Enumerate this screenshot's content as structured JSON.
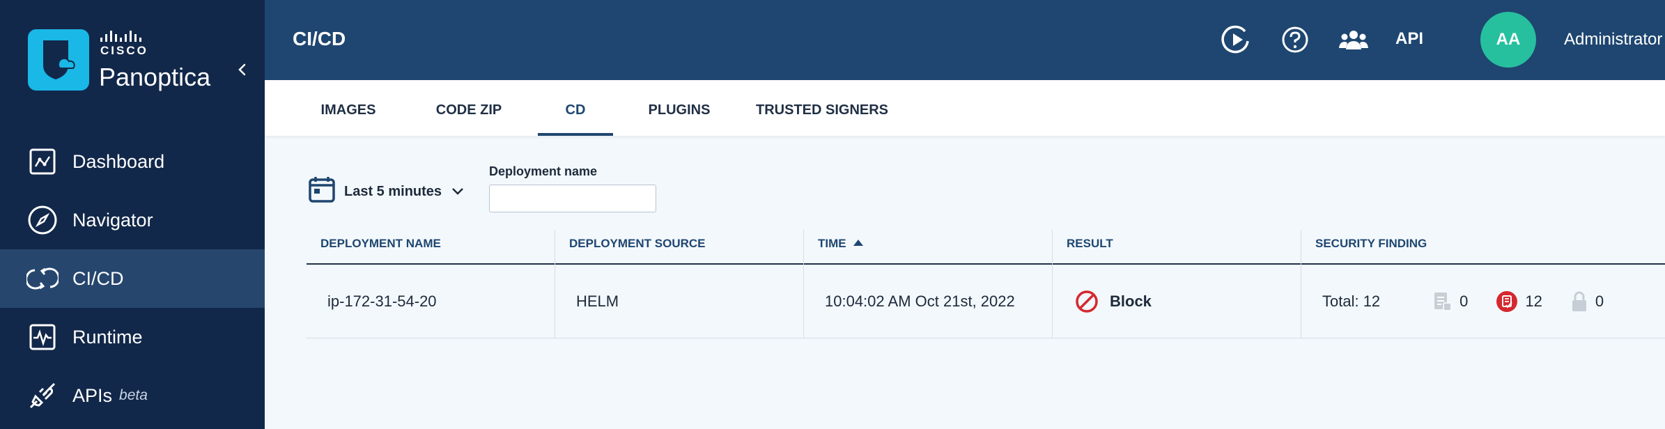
{
  "brand": {
    "company": "CISCO",
    "product": "Panoptica"
  },
  "sidebar": {
    "items": [
      {
        "label": "Dashboard",
        "icon": "dashboard-icon"
      },
      {
        "label": "Navigator",
        "icon": "compass-icon"
      },
      {
        "label": "CI/CD",
        "icon": "cicd-icon",
        "active": true
      },
      {
        "label": "Runtime",
        "icon": "runtime-icon"
      },
      {
        "label": "APIs",
        "badge": "beta",
        "icon": "api-plug-icon"
      }
    ]
  },
  "header": {
    "title": "CI/CD",
    "api_label": "API",
    "avatar_initials": "AA",
    "user_name": "Administrator"
  },
  "tabs": [
    {
      "label": "IMAGES"
    },
    {
      "label": "CODE ZIP"
    },
    {
      "label": "CD",
      "active": true
    },
    {
      "label": "PLUGINS"
    },
    {
      "label": "TRUSTED SIGNERS"
    }
  ],
  "filters": {
    "time_range": "Last 5 minutes",
    "deployment_name_label": "Deployment name",
    "deployment_name_value": "",
    "deployment_name_placeholder": ""
  },
  "table": {
    "columns": [
      "DEPLOYMENT NAME",
      "DEPLOYMENT SOURCE",
      "TIME",
      "RESULT",
      "SECURITY FINDING"
    ],
    "sort_column": "TIME",
    "sort_direction": "ascending",
    "rows": [
      {
        "deployment_name": "ip-172-31-54-20",
        "deployment_source": "HELM",
        "time": "10:04:02 AM Oct 21st, 2022",
        "result": "Block",
        "security_finding": {
          "total": "Total: 12",
          "counts": [
            "0",
            "12",
            "0"
          ]
        }
      }
    ]
  },
  "colors": {
    "sidebar_bg": "#12284a",
    "header_bg": "#1e4670",
    "accent": "#19b8e6",
    "avatar": "#27c09f",
    "block_red": "#d4292f"
  }
}
